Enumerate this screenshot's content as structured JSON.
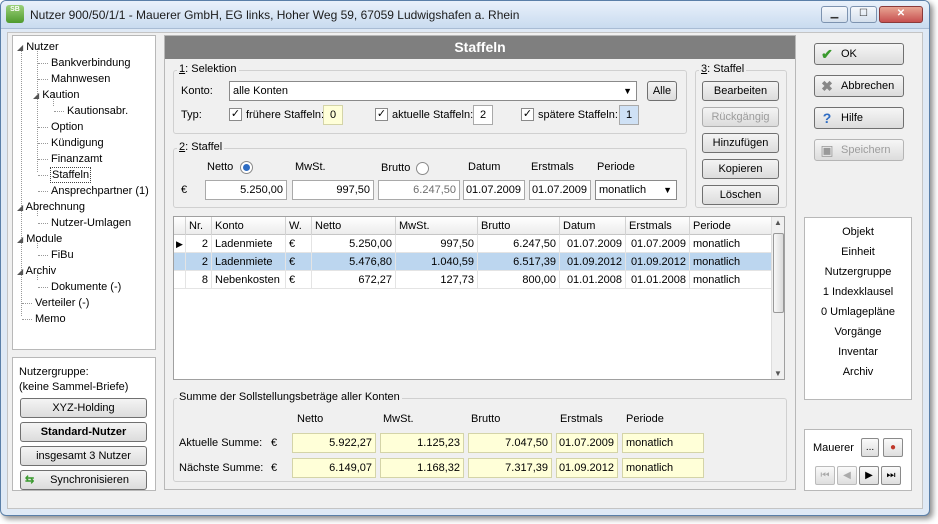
{
  "window": {
    "title": "Nutzer 900/50/1/1 - Mauerer GmbH, EG links, Hoher Weg 59, 67059 Ludwigshafen a. Rhein",
    "app_icon_text": "SB"
  },
  "tree": {
    "items": [
      {
        "label": "Nutzer"
      },
      {
        "label": "Bankverbindung"
      },
      {
        "label": "Mahnwesen"
      },
      {
        "label": "Kaution"
      },
      {
        "label": "Kautionsabr."
      },
      {
        "label": "Option"
      },
      {
        "label": "Kündigung"
      },
      {
        "label": "Finanzamt"
      },
      {
        "label": "Staffeln"
      },
      {
        "label": "Ansprechpartner (1)"
      },
      {
        "label": "Abrechnung"
      },
      {
        "label": "Nutzer-Umlagen"
      },
      {
        "label": "Module"
      },
      {
        "label": "FiBu"
      },
      {
        "label": "Archiv"
      },
      {
        "label": "Dokumente (-)"
      },
      {
        "label": "Verteiler (-)"
      },
      {
        "label": "Memo"
      }
    ]
  },
  "nutzergruppe": {
    "line1": "Nutzergruppe:",
    "line2": "(keine Sammel-Briefe)",
    "btn_holding": "XYZ-Holding",
    "btn_standard": "Standard-Nutzer",
    "btn_count": "insgesamt 3 Nutzer",
    "btn_sync": "Synchronisieren"
  },
  "main": {
    "header": "Staffeln",
    "selektion": {
      "title_num": "1",
      "title": ": Selektion",
      "konto_label": "Konto:",
      "konto_value": "alle Konten",
      "alle_btn": "Alle",
      "typ_label": "Typ:",
      "fruehere_label": "frühere Staffeln:",
      "fruehere_count": "0",
      "aktuelle_label": "aktuelle Staffeln:",
      "aktuelle_count": "2",
      "spaetere_label": "spätere Staffeln:",
      "spaetere_count": "1"
    },
    "staffel_edit": {
      "title_num": "2",
      "title": ": Staffel",
      "col_netto": "Netto",
      "col_mwst": "MwSt.",
      "col_brutto": "Brutto",
      "col_datum": "Datum",
      "col_erstmals": "Erstmals",
      "col_periode": "Periode",
      "currency": "€",
      "netto": "5.250,00",
      "mwst": "997,50",
      "brutto": "6.247,50",
      "datum": "01.07.2009",
      "erstmals": "01.07.2009",
      "periode": "monatlich"
    },
    "staffel_actions": {
      "title_num": "3",
      "title": ": Staffel",
      "bearbeiten": "Bearbeiten",
      "rueckgaengig": "Rückgängig",
      "hinzufuegen": "Hinzufügen",
      "kopieren": "Kopieren",
      "loeschen": "Löschen"
    },
    "table": {
      "columns": [
        "Nr.",
        "Konto",
        "W.",
        "Netto",
        "MwSt.",
        "Brutto",
        "Datum",
        "Erstmals",
        "Periode"
      ],
      "rows": [
        {
          "marker": "▶",
          "nr": "2",
          "konto": "Ladenmiete",
          "w": "€",
          "netto": "5.250,00",
          "mwst": "997,50",
          "brutto": "6.247,50",
          "datum": "01.07.2009",
          "erstmals": "01.07.2009",
          "periode": "monatlich"
        },
        {
          "marker": "",
          "nr": "2",
          "konto": "Ladenmiete",
          "w": "€",
          "netto": "5.476,80",
          "mwst": "1.040,59",
          "brutto": "6.517,39",
          "datum": "01.09.2012",
          "erstmals": "01.09.2012",
          "periode": "monatlich"
        },
        {
          "marker": "",
          "nr": "8",
          "konto": "Nebenkosten",
          "w": "€",
          "netto": "672,27",
          "mwst": "127,73",
          "brutto": "800,00",
          "datum": "01.01.2008",
          "erstmals": "01.01.2008",
          "periode": "monatlich"
        }
      ]
    },
    "summe": {
      "title": "Summe der Sollstellungsbeträge aller Konten",
      "col_netto": "Netto",
      "col_mwst": "MwSt.",
      "col_brutto": "Brutto",
      "col_erstmals": "Erstmals",
      "col_periode": "Periode",
      "aktuelle_label": "Aktuelle Summe:",
      "naechste_label": "Nächste Summe:",
      "currency": "€",
      "aktuelle": {
        "netto": "5.922,27",
        "mwst": "1.125,23",
        "brutto": "7.047,50",
        "erstmals": "01.07.2009",
        "periode": "monatlich"
      },
      "naechste": {
        "netto": "6.149,07",
        "mwst": "1.168,32",
        "brutto": "7.317,39",
        "erstmals": "01.09.2012",
        "periode": "monatlich"
      }
    }
  },
  "right_buttons": {
    "ok": "OK",
    "abbrechen": "Abbrechen",
    "hilfe": "Hilfe",
    "speichern": "Speichern"
  },
  "info_list": [
    "Objekt",
    "Einheit",
    "Nutzergruppe",
    "1 Indexklausel",
    "0 Umlagepläne",
    "Vorgänge",
    "Inventar",
    "Archiv"
  ],
  "nav": {
    "user": "Mauerer",
    "more_btn": "..."
  },
  "colors": {
    "header_bg": "#7f7f7f",
    "selected_row": "#bcd6ef",
    "sum_field_bg": "#ffffd8"
  }
}
